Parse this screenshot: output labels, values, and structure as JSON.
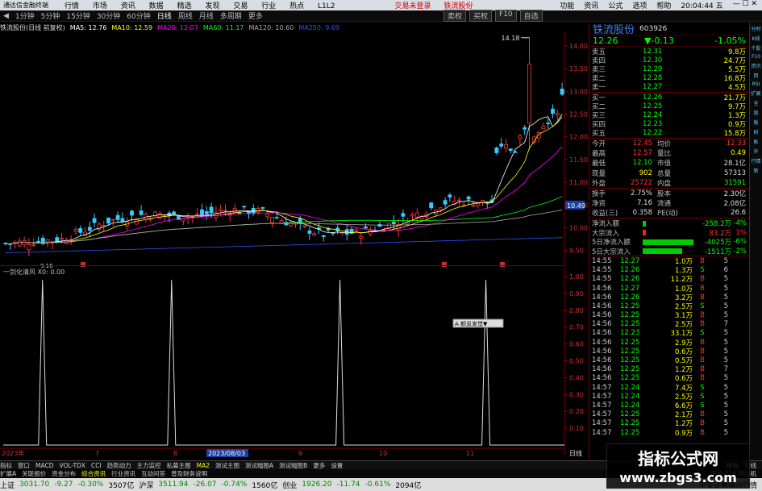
{
  "titlebar": {
    "app": "通达信金融终端",
    "menu": [
      "行情",
      "市场",
      "资讯",
      "数据",
      "精选",
      "发现",
      "交易",
      "行业",
      "热点",
      "L1L2"
    ],
    "alert": "交易未登录",
    "stock_link": "铁流股份",
    "right": [
      "功能",
      "资讯",
      "公式",
      "选项",
      "帮助"
    ],
    "time": "20:04:44 五"
  },
  "toolbar": {
    "periods": [
      "1分钟",
      "5分钟",
      "15分钟",
      "30分钟",
      "60分钟",
      "日线",
      "周线",
      "月线",
      "多周期",
      "更多"
    ],
    "selected": "日线",
    "buttons": [
      "卖权",
      "买权",
      "F10",
      "自选"
    ]
  },
  "maininfo": {
    "title": "铁流股份(日线 前复权)",
    "ma": [
      {
        "t": "MA5: 12.76",
        "c": "#ffffff"
      },
      {
        "t": "MA10: 12.59",
        "c": "#ffff00"
      },
      {
        "t": "MA20: 12.07",
        "c": "#ff00ff"
      },
      {
        "t": "MA60: 11.17",
        "c": "#00ff00"
      },
      {
        "t": "MA120: 10.60",
        "c": "#aaaaaa"
      },
      {
        "t": "MA250: 9.69",
        "c": "#3050ff"
      }
    ]
  },
  "chart_data": {
    "type": "candlestick",
    "price_axis": [
      "14.00",
      "13.50",
      "13.00",
      "12.50",
      "12.00",
      "11.50",
      "11.00",
      "10.50",
      "10.00",
      "9.50"
    ],
    "price_range": [
      9.3,
      14.3
    ],
    "high_label": "14.18",
    "low_label": "9.16",
    "current_tag": "10.49",
    "indicator_title": "一剑化清风  X0: 0.00",
    "indicator_axis": [
      "1.00",
      "0.90",
      "0.80",
      "0.70",
      "0.60",
      "0.50",
      "0.40",
      "0.30",
      "0.20",
      "0.10"
    ],
    "spikes": [
      0.07,
      0.3,
      0.6,
      0.86
    ],
    "dates": [
      "2023年",
      "7",
      "8",
      "2023/08/03",
      "9",
      "10",
      "11"
    ],
    "tooltip": "A 额息发觉▼",
    "right_label": "日线"
  },
  "quote": {
    "name": "铁流股份",
    "code": "603926",
    "price": "12.26",
    "change": "▼-0.13",
    "pct": "-1.05%",
    "asks": [
      {
        "l": "卖五",
        "p": "12.31",
        "v": "9.8万"
      },
      {
        "l": "卖四",
        "p": "12.30",
        "v": "24.7万"
      },
      {
        "l": "卖三",
        "p": "12.29",
        "v": "5.5万"
      },
      {
        "l": "卖二",
        "p": "12.28",
        "v": "16.8万"
      },
      {
        "l": "卖一",
        "p": "12.27",
        "v": "4.5万"
      }
    ],
    "bids": [
      {
        "l": "买一",
        "p": "12.26",
        "v": "21.7万"
      },
      {
        "l": "买二",
        "p": "12.25",
        "v": "9.7万"
      },
      {
        "l": "买三",
        "p": "12.24",
        "v": "1.3万"
      },
      {
        "l": "买四",
        "p": "12.23",
        "v": "0.9万"
      },
      {
        "l": "买五",
        "p": "12.22",
        "v": "15.8万"
      }
    ],
    "fields": [
      {
        "l": "今开",
        "v": "12.45",
        "vc": "red",
        "l2": "均价",
        "v2": "12.33",
        "v2c": "red"
      },
      {
        "l": "最高",
        "v": "12.57",
        "vc": "red",
        "l2": "量比",
        "v2": "0.49",
        "v2c": "yel"
      },
      {
        "l": "最低",
        "v": "12.10",
        "vc": "grn",
        "l2": "市值",
        "v2": "28.1亿",
        "v2c": "wh"
      },
      {
        "l": "现量",
        "v": "902",
        "vc": "yel",
        "l2": "总量",
        "v2": "57313",
        "v2c": "wh"
      },
      {
        "l": "外盘",
        "v": "25722",
        "vc": "red",
        "l2": "内盘",
        "v2": "31591",
        "v2c": "grn"
      }
    ],
    "fields2": [
      {
        "l": "换手",
        "v": "2.75%",
        "vc": "wh",
        "l2": "股本",
        "v2": "2.30亿",
        "v2c": "wh"
      },
      {
        "l": "净资",
        "v": "7.16",
        "vc": "wh",
        "l2": "流通",
        "v2": "2.08亿",
        "v2c": "wh"
      },
      {
        "l": "收益(三)",
        "v": "0.358",
        "vc": "wh",
        "l2": "PE(动)",
        "v2": "26.6",
        "v2c": "wh"
      }
    ],
    "flows": [
      {
        "l": "净流入额",
        "v": "-258.2万",
        "p": "-4%",
        "w": 0.05
      },
      {
        "l": "大宗流入",
        "v": "83.2万",
        "p": "1%",
        "w": 0.05
      },
      {
        "l": "5日净流入额",
        "v": "-4025万",
        "p": "-6%",
        "w": 0.9
      },
      {
        "l": "5日大宗流入",
        "v": "-1511万",
        "p": "-2%",
        "w": 0.7
      }
    ],
    "ticks": [
      {
        "t": "14:55",
        "p": "12.27",
        "v": "1.0万",
        "s": "B",
        "n": "5"
      },
      {
        "t": "14:55",
        "p": "12.26",
        "v": "1.3万",
        "s": "S",
        "n": "6"
      },
      {
        "t": "14:55",
        "p": "12.26",
        "v": "11.2万",
        "s": "B",
        "n": "5"
      },
      {
        "t": "14:56",
        "p": "12.27",
        "v": "1.0万",
        "s": "B",
        "n": "5"
      },
      {
        "t": "14:56",
        "p": "12.26",
        "v": "3.2万",
        "s": "B",
        "n": "5"
      },
      {
        "t": "14:56",
        "p": "12.25",
        "v": "2.5万",
        "s": "S",
        "n": "5"
      },
      {
        "t": "14:56",
        "p": "12.25",
        "v": "3.1万",
        "s": "B",
        "n": "5"
      },
      {
        "t": "14:56",
        "p": "12.25",
        "v": "2.5万",
        "s": "B",
        "n": "7"
      },
      {
        "t": "14:56",
        "p": "12.23",
        "v": "33.1万",
        "s": "S",
        "n": "5"
      },
      {
        "t": "14:56",
        "p": "12.25",
        "v": "2.9万",
        "s": "B",
        "n": "5"
      },
      {
        "t": "14:56",
        "p": "12.25",
        "v": "0.6万",
        "s": "B",
        "n": "5"
      },
      {
        "t": "14:56",
        "p": "12.25",
        "v": "0.5万",
        "s": "B",
        "n": "5"
      },
      {
        "t": "14:56",
        "p": "12.25",
        "v": "1.2万",
        "s": "B",
        "n": "7"
      },
      {
        "t": "14:56",
        "p": "12.25",
        "v": "0.6万",
        "s": "B",
        "n": "5"
      },
      {
        "t": "14:57",
        "p": "12.24",
        "v": "7.4万",
        "s": "S",
        "n": "5"
      },
      {
        "t": "14:57",
        "p": "12.24",
        "v": "2.5万",
        "s": "S",
        "n": "5"
      },
      {
        "t": "14:57",
        "p": "12.24",
        "v": "6.6万",
        "s": "S",
        "n": "5"
      },
      {
        "t": "14:57",
        "p": "12.25",
        "v": "2.1万",
        "s": "B",
        "n": "5"
      },
      {
        "t": "14:57",
        "p": "12.25",
        "v": "1.2万",
        "s": "B",
        "n": "5"
      },
      {
        "t": "14:57",
        "p": "12.25",
        "v": "0.9万",
        "s": "B",
        "n": "5"
      }
    ]
  },
  "rightstrip": [
    "分时",
    "K线",
    "个股",
    "F10",
    "资讯",
    "回",
    "RSI",
    "扩展",
    "全",
    "级",
    "板",
    "财",
    "账",
    "外",
    "行情",
    "新"
  ],
  "bottabs": {
    "items": [
      "指标",
      "窗口",
      "MACD",
      "VOL-TDX",
      "CCI",
      "趋势动力",
      "主力监控",
      "私募主图",
      "MA2",
      "测试主图",
      "测试幅图A",
      "测试幅图B",
      "更多",
      "设置"
    ],
    "selected": "MA2",
    "right": [
      "模板",
      "日线"
    ]
  },
  "bottabs2": {
    "items": [
      "扩展A",
      "关联报价",
      "资金分布",
      "综合资讯",
      "行业资讯",
      "互动问答",
      "普及财务说明"
    ],
    "selected": "综合资讯",
    "right": "图文 F10 到位机"
  },
  "statusbar": [
    {
      "l": "上证",
      "v": "3031.70",
      "c": "-9.27",
      "p": "-0.30%",
      "a": "3507亿"
    },
    {
      "l": "沪深",
      "v": "3511.94",
      "c": "-26.07",
      "p": "-0.74%",
      "a": "1560亿"
    },
    {
      "l": "创业",
      "v": "1926.20",
      "c": "-11.74",
      "p": "-0.61%",
      "a": "2094亿"
    }
  ],
  "status_right": "平安证券福州行情",
  "watermark": {
    "line1": "指标公式网",
    "line2": "www.zbgs3.com"
  }
}
